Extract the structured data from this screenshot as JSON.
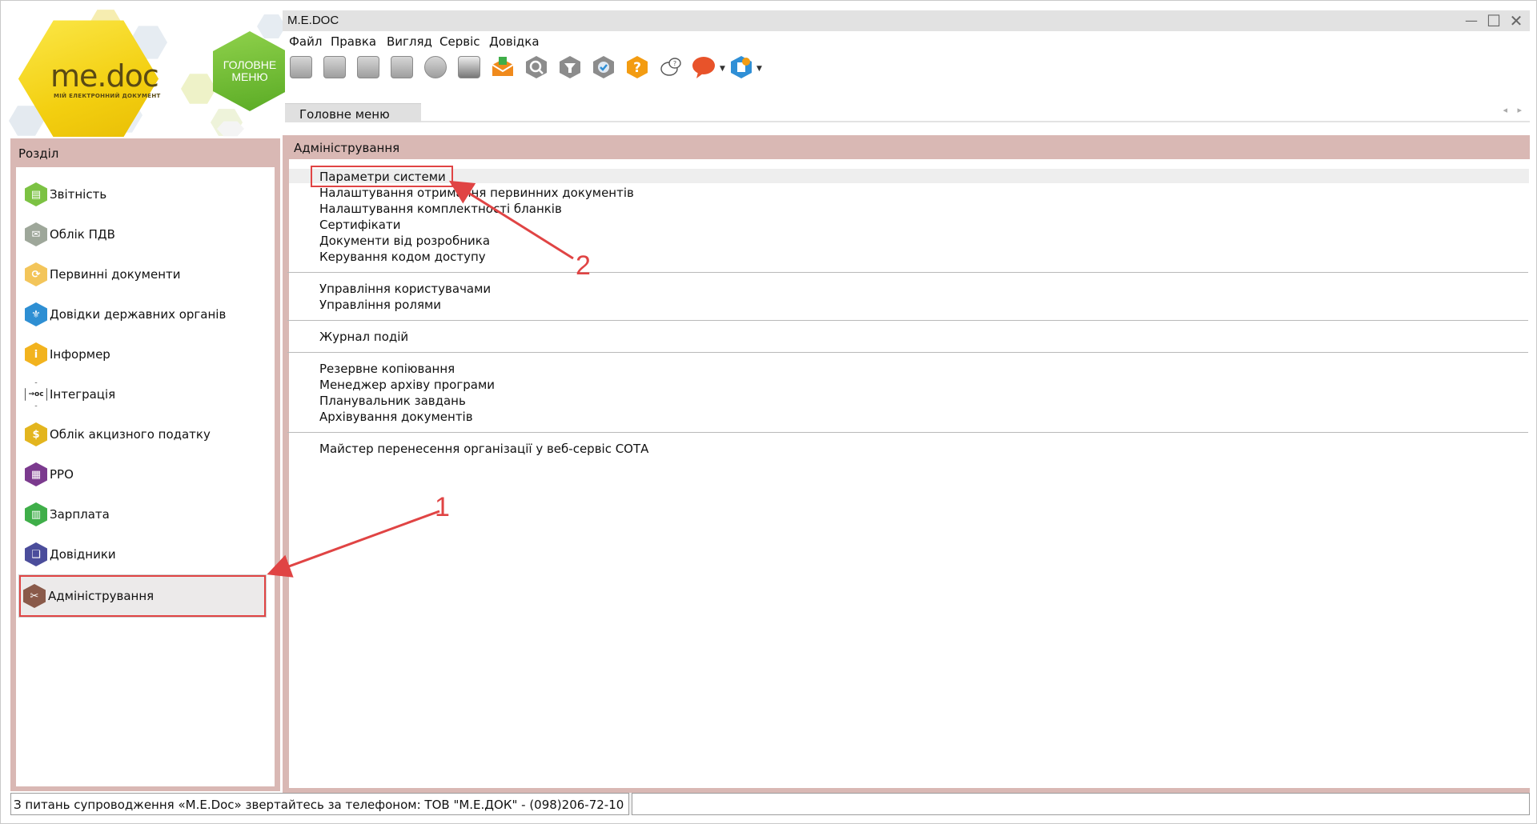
{
  "window": {
    "title": "M.E.DOC",
    "minimize": "—",
    "maximize": "☐",
    "close": "✕"
  },
  "logo": {
    "brand": "me.doc",
    "tagline": "МІЙ ЕЛЕКТРОННИЙ ДОКУМЕНТ",
    "home_line1": "ГОЛОВНЕ",
    "home_line2": "МЕНЮ"
  },
  "menu": [
    "Файл",
    "Правка",
    "Вигляд",
    "Сервіс",
    "Довідка"
  ],
  "toolbar": {
    "icons": [
      "new-doc-icon",
      "add-doc-icon",
      "edit-doc-icon",
      "delete-doc-icon",
      "save-disk-icon",
      "print-icon",
      "send-envelope-icon",
      "find-icon",
      "filter-icon",
      "verify-shield-icon",
      "help-question-icon",
      "support-chat-icon",
      "feedback-bubble-icon",
      "updates-icon"
    ],
    "colors": {
      "send": "#f08a1c",
      "help": "#f39c12",
      "feedback": "#e8532a",
      "updates": "#2f8fd6"
    }
  },
  "tabs": {
    "main": "Головне меню",
    "nav_left": "◂",
    "nav_right": "▸"
  },
  "sidebar": {
    "header": "Розділ",
    "items": [
      {
        "label": "Звітність",
        "icon": "reports-icon",
        "color": "#7cc243",
        "glyph": "▤"
      },
      {
        "label": "Облік ПДВ",
        "icon": "vat-icon",
        "color": "#9ea79a",
        "glyph": "✉"
      },
      {
        "label": "Первинні документи",
        "icon": "primary-docs-icon",
        "color": "#f3c55a",
        "glyph": "⟳"
      },
      {
        "label": "Довідки державних органів",
        "icon": "gov-certificates-icon",
        "color": "#2e8fd3",
        "glyph": "⚜"
      },
      {
        "label": "Інформер",
        "icon": "informer-icon",
        "color": "#f2b31e",
        "glyph": "i"
      },
      {
        "label": "Інтеграція",
        "icon": "integration-icon",
        "color": "#ffffff",
        "glyph": "→oc"
      },
      {
        "label": "Облік акцизного податку",
        "icon": "excise-icon",
        "color": "#e3b51e",
        "glyph": "$"
      },
      {
        "label": "РРО",
        "icon": "rro-icon",
        "color": "#7b3a8e",
        "glyph": "▦"
      },
      {
        "label": "Зарплата",
        "icon": "salary-icon",
        "color": "#3fae49",
        "glyph": "▥"
      },
      {
        "label": "Довідники",
        "icon": "directories-icon",
        "color": "#4b4d9b",
        "glyph": "📖"
      },
      {
        "label": "Адміністрування",
        "icon": "administration-icon",
        "color": "#8a5a4a",
        "glyph": "✂"
      }
    ],
    "selected_index": 10
  },
  "content": {
    "header": "Адміністрування",
    "groups": [
      [
        "Параметри системи",
        "Налаштування отримання первинних документів",
        "Налаштування комплектності бланків",
        "Сертифікати",
        "Документи від розробника",
        "Керування кодом доступу"
      ],
      [
        "Управління користувачами",
        "Управління ролями"
      ],
      [
        "Журнал подій"
      ],
      [
        "Резервне копіювання",
        "Менеджер архіву програми",
        "Планувальник завдань",
        "Архівування документів"
      ],
      [
        "Майстер перенесення організації у веб-сервіс СОТА"
      ]
    ]
  },
  "annotations": {
    "step1": "1",
    "step2": "2",
    "color": "#e04444"
  },
  "status": {
    "text": "З питань супроводження «M.E.Doc» звертайтесь за телефоном: ТОВ \"М.Е.ДОК\" - (098)206-72-10",
    "right": ""
  }
}
